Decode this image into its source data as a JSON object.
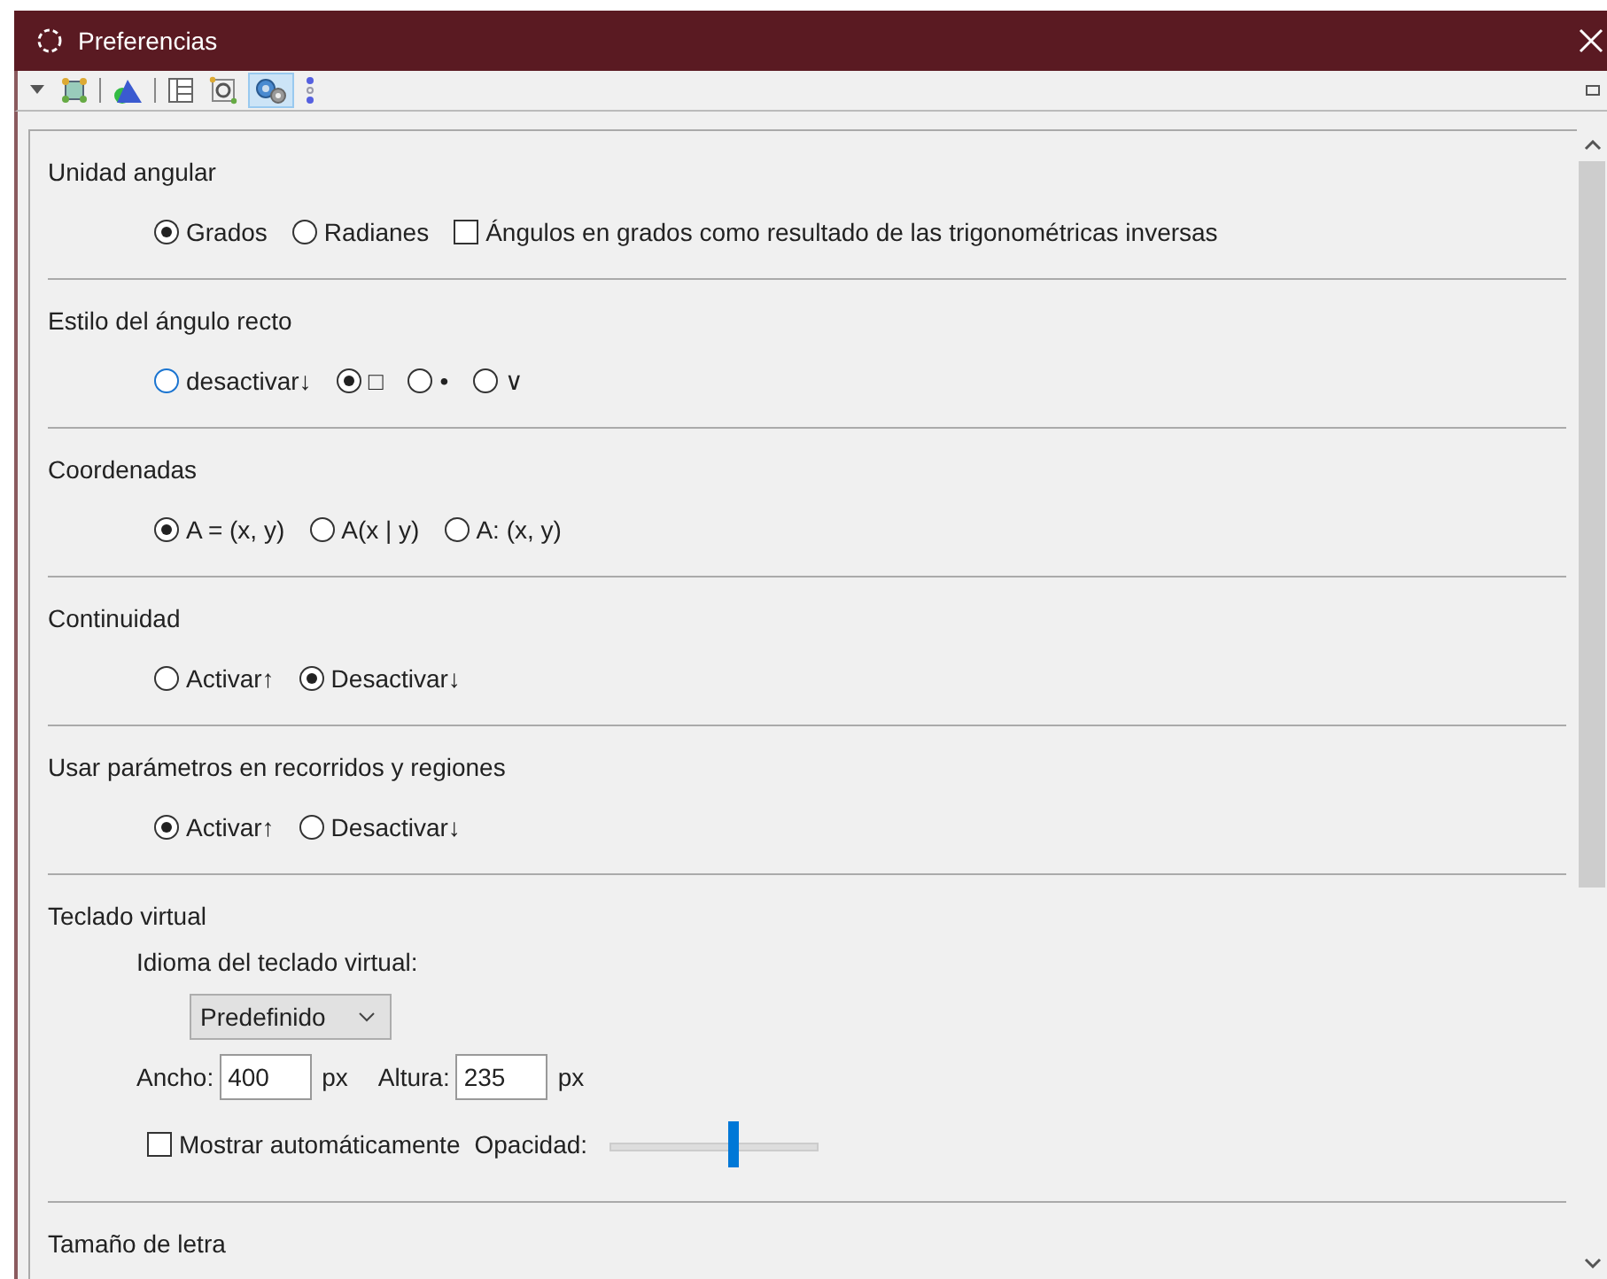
{
  "window": {
    "title": "Preferencias"
  },
  "toolbar": {
    "tools": [
      {
        "kind": "menu",
        "selected": false
      },
      {
        "kind": "points",
        "selected": false
      },
      {
        "kind": "shapes",
        "selected": false
      },
      {
        "kind": "layout",
        "selected": false
      },
      {
        "kind": "graphics",
        "selected": false
      },
      {
        "kind": "gears",
        "selected": true
      },
      {
        "kind": "dots",
        "selected": false
      }
    ]
  },
  "sections": [
    {
      "kind": "radio",
      "title": "Unidad angular",
      "options": [
        {
          "label": "Grados",
          "selected": true
        },
        {
          "label": "Radianes",
          "selected": false
        }
      ],
      "checkbox": {
        "label": "Ángulos en grados como resultado de las trigonométricas inversas",
        "checked": false
      }
    },
    {
      "kind": "radio",
      "title": "Estilo del ángulo recto",
      "options": [
        {
          "label": "desactivar↓",
          "selected": false
        },
        {
          "label": "□",
          "selected": true
        },
        {
          "label": "•",
          "selected": false
        },
        {
          "label": "∨",
          "selected": false
        }
      ]
    },
    {
      "kind": "radio",
      "title": "Coordenadas",
      "options": [
        {
          "label": "A = (x, y)",
          "selected": true
        },
        {
          "label": "A(x | y)",
          "selected": false
        },
        {
          "label": "A: (x, y)",
          "selected": false
        }
      ]
    },
    {
      "kind": "radio",
      "title": "Continuidad",
      "options": [
        {
          "label": "Activar↑",
          "selected": false
        },
        {
          "label": "Desactivar↓",
          "selected": true
        }
      ]
    },
    {
      "kind": "radio",
      "title": "Usar parámetros en recorridos y regiones",
      "options": [
        {
          "label": "Activar↑",
          "selected": true
        },
        {
          "label": "Desactivar↓",
          "selected": false
        }
      ]
    },
    {
      "kind": "keyboard",
      "title": "Teclado virtual",
      "language_label": "Idioma del teclado virtual:",
      "language": "Predefinido",
      "width": {
        "label": "Ancho:",
        "value": "400",
        "unit": "px"
      },
      "height": {
        "label": "Altura:",
        "value": "235",
        "unit": "px"
      },
      "autoshow": {
        "label": "Mostrar automáticamente",
        "checked": false
      },
      "opacity": {
        "label": "Opacidad:",
        "level": 0.6
      }
    },
    {
      "kind": "title",
      "title": "Tamaño de letra"
    }
  ]
}
